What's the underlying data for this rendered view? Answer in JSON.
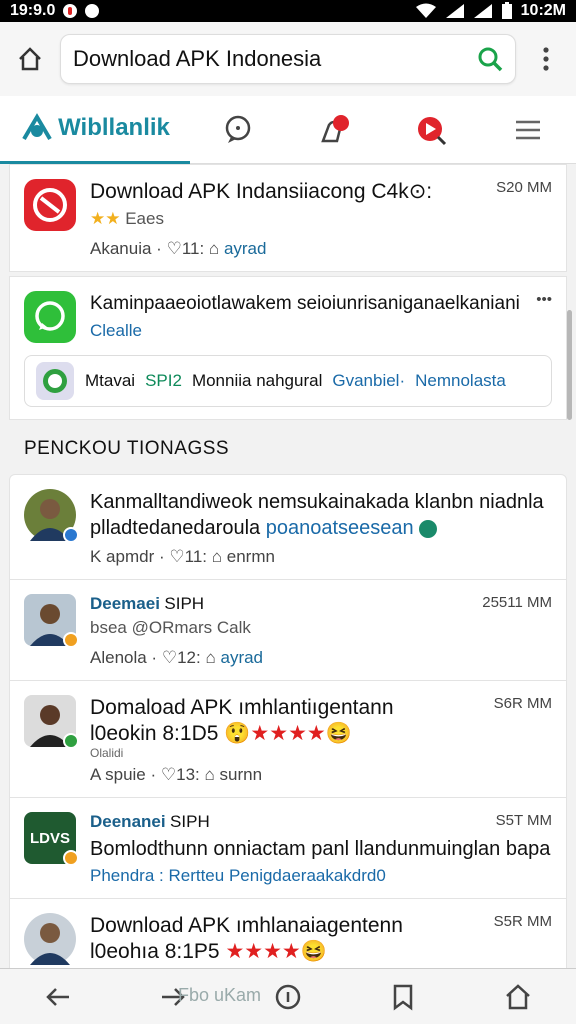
{
  "status": {
    "time_left": "19:9.0",
    "time_right": "10:2M"
  },
  "urlbar": {
    "query": "Download APK Indonesia"
  },
  "tabs": {
    "logo_text": "Wibllanlik"
  },
  "apps": [
    {
      "title": "Download APK Indansiiacong C4k⊙:",
      "rating_text": "Eaes",
      "meta_left": "Akanuia ·",
      "meta_mid": "11:",
      "meta_right": "ayrad",
      "time": "S20 MM",
      "icon_color": "#e0242c"
    },
    {
      "title": "Kaminpaaeoiotlawakem seioiunrisaniganaelkaniani",
      "link": "Clealle",
      "menu": "•••",
      "icon_color": "#2fbf3a"
    }
  ],
  "promo": {
    "left": "Mtavai",
    "green": "SPI2",
    "middle": "Monniia nahgural",
    "link1": "Gvanbiel·",
    "link2": "Nemnolasta"
  },
  "section_title": "PENCKOU TIONAGSS",
  "posts": [
    {
      "title": "Kanmalltandiweok nemsukainakada klanbn niadnla",
      "sub_a": "plladtedanedaroula",
      "sub_b": "poanoatseesean",
      "meta_left": "K apmdr ·",
      "meta_mid": "11:",
      "meta_right": "enrmn",
      "badge": "#2a78d0"
    },
    {
      "name": "Deemaei",
      "name_suffix": "SIPH",
      "time": "25511 MM",
      "sub": "bsea @ORmars Calk",
      "meta_left": "Alenola ·",
      "meta_mid": "12:",
      "meta_right": "ayrad",
      "badge": "#f0a020"
    },
    {
      "title": "Domaload APK ımhlantiıgentann",
      "sub_a": "l0eokin 8:1D5",
      "small": "Olalidi",
      "meta_left": "A spuie ·",
      "meta_mid": "13:",
      "meta_right": "surnn",
      "time": "S6R MM",
      "badge": "#2fa040"
    },
    {
      "name": "Deenanei",
      "name_suffix": "SIPH",
      "time": "S5T MM",
      "title": "Bomlodthunn onniactam panl llandunmuinglan bapa",
      "link_a": "Phendra :",
      "link_b": "Rertteu Penigdaeraakakdrd0",
      "logo_text": "LDVS",
      "badge": "#f0a020"
    },
    {
      "title": "Download APK ımhlanaiagentenn",
      "sub_a": "l0eohıa 8:1P5",
      "time": "S5R MM"
    }
  ],
  "bottom": {
    "ghost_text": "Fbo uKam"
  }
}
